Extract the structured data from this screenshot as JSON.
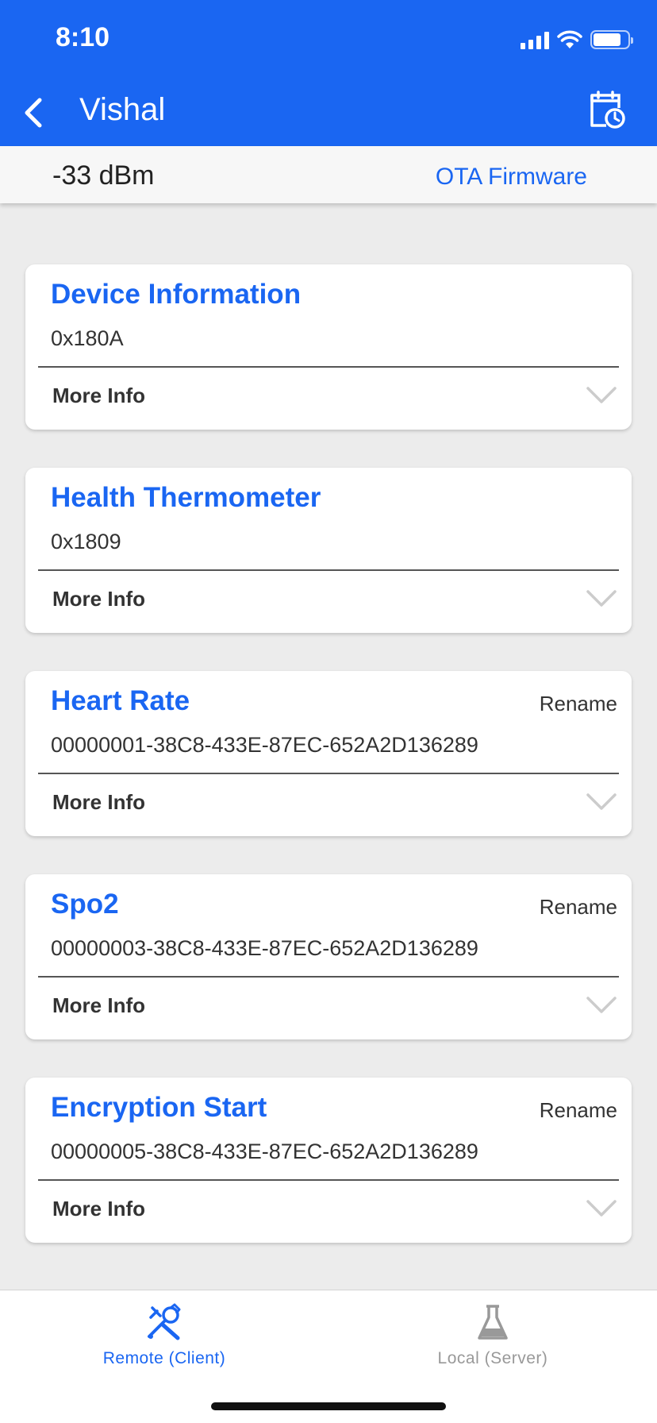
{
  "status_bar": {
    "time": "8:10"
  },
  "nav": {
    "title": "Vishal"
  },
  "subbar": {
    "rssi": "-33 dBm",
    "ota_label": "OTA Firmware"
  },
  "services": [
    {
      "name": "Device Information",
      "uuid": "0x180A",
      "rename": "",
      "more": "More Info"
    },
    {
      "name": "Health Thermometer",
      "uuid": "0x1809",
      "rename": "",
      "more": "More Info"
    },
    {
      "name": "Heart Rate",
      "uuid": "00000001-38C8-433E-87EC-652A2D136289",
      "rename": "Rename",
      "more": "More Info"
    },
    {
      "name": "Spo2",
      "uuid": "00000003-38C8-433E-87EC-652A2D136289",
      "rename": "Rename",
      "more": "More Info"
    },
    {
      "name": "Encryption Start",
      "uuid": "00000005-38C8-433E-87EC-652A2D136289",
      "rename": "Rename",
      "more": "More Info"
    }
  ],
  "tabs": [
    {
      "label": "Remote (Client)",
      "icon": "tools-icon",
      "active": true
    },
    {
      "label": "Local (Server)",
      "icon": "flask-icon",
      "active": false
    }
  ],
  "colors": {
    "accent": "#1a66f2",
    "background": "#ececec",
    "inactive_tab": "#999999"
  }
}
